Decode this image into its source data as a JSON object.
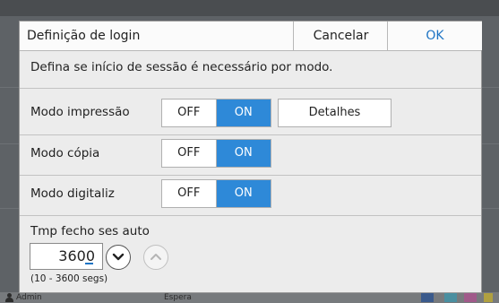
{
  "background": {
    "status_user": "Admin",
    "status_state": "Espera"
  },
  "dialog": {
    "title": "Definição de login",
    "cancel_label": "Cancelar",
    "ok_label": "OK",
    "description": "Defina se início de sessão é necessário por modo.",
    "rows": [
      {
        "label": "Modo impressão",
        "off": "OFF",
        "on": "ON",
        "value": "ON"
      },
      {
        "label": "Modo cópia",
        "off": "OFF",
        "on": "ON",
        "value": "ON"
      },
      {
        "label": "Modo digitaliz",
        "off": "OFF",
        "on": "ON",
        "value": "ON"
      }
    ],
    "details_label": "Detalhes",
    "timeout": {
      "label": "Tmp fecho ses auto",
      "value": "3600",
      "range": "(10 - 3600 segs)"
    }
  },
  "colors": {
    "accent": "#2e89d8",
    "ok_text": "#1e74c4",
    "overlay": "#5e6266"
  },
  "icons": {
    "decrement": "chevron-down-icon",
    "increment": "chevron-up-icon",
    "user": "user-icon"
  }
}
